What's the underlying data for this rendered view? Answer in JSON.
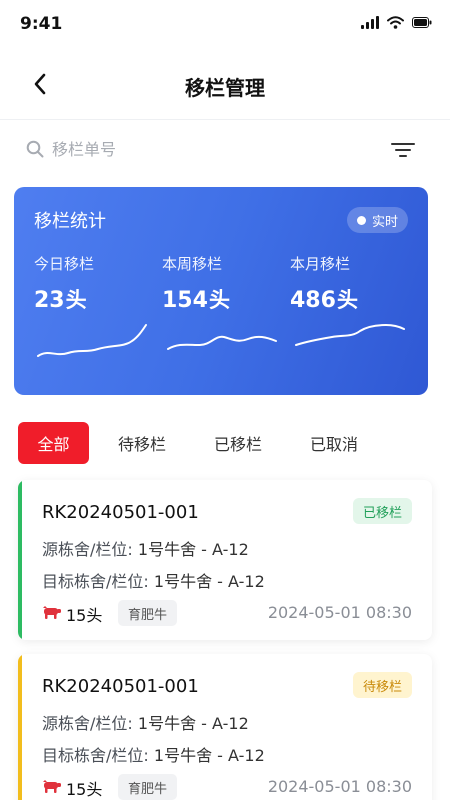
{
  "status_bar": {
    "time": "9:41"
  },
  "nav": {
    "title": "移栏管理"
  },
  "search": {
    "placeholder": "移栏单号"
  },
  "stats": {
    "title": "移栏统计",
    "badge": "实时",
    "items": [
      {
        "label": "今日移栏",
        "value": "23",
        "unit": "头"
      },
      {
        "label": "本周移栏",
        "value": "154",
        "unit": "头"
      },
      {
        "label": "本月移栏",
        "value": "486",
        "unit": "头"
      }
    ]
  },
  "tabs": [
    {
      "label": "全部",
      "active": true
    },
    {
      "label": "待移栏",
      "active": false
    },
    {
      "label": "已移栏",
      "active": false
    },
    {
      "label": "已取消",
      "active": false
    }
  ],
  "records": [
    {
      "id": "RK20240501-001",
      "status": "已移栏",
      "status_color": "#22a05a",
      "status_bg": "#e3f6ea",
      "accent": "#2dbb62",
      "source_label": "源栋舍/栏位:",
      "source_value": "1号牛舍 - A-12",
      "target_label": "目标栋舍/栏位:",
      "target_value": "1号牛舍 - A-12",
      "count": "15头",
      "breed": "育肥牛",
      "time": "2024-05-01 08:30"
    },
    {
      "id": "RK20240501-001",
      "status": "待移栏",
      "status_color": "#c98a0a",
      "status_bg": "#fff4cf",
      "accent": "#f2bd1d",
      "source_label": "源栋舍/栏位:",
      "source_value": "1号牛舍 - A-12",
      "target_label": "目标栋舍/栏位:",
      "target_value": "1号牛舍 - A-12",
      "count": "15头",
      "breed": "育肥牛",
      "time": "2024-05-01 08:30"
    }
  ],
  "colors": {
    "primary": "#3f6fe6",
    "active_tab": "#f01d2a",
    "cattle_icon": "#e0323c"
  }
}
